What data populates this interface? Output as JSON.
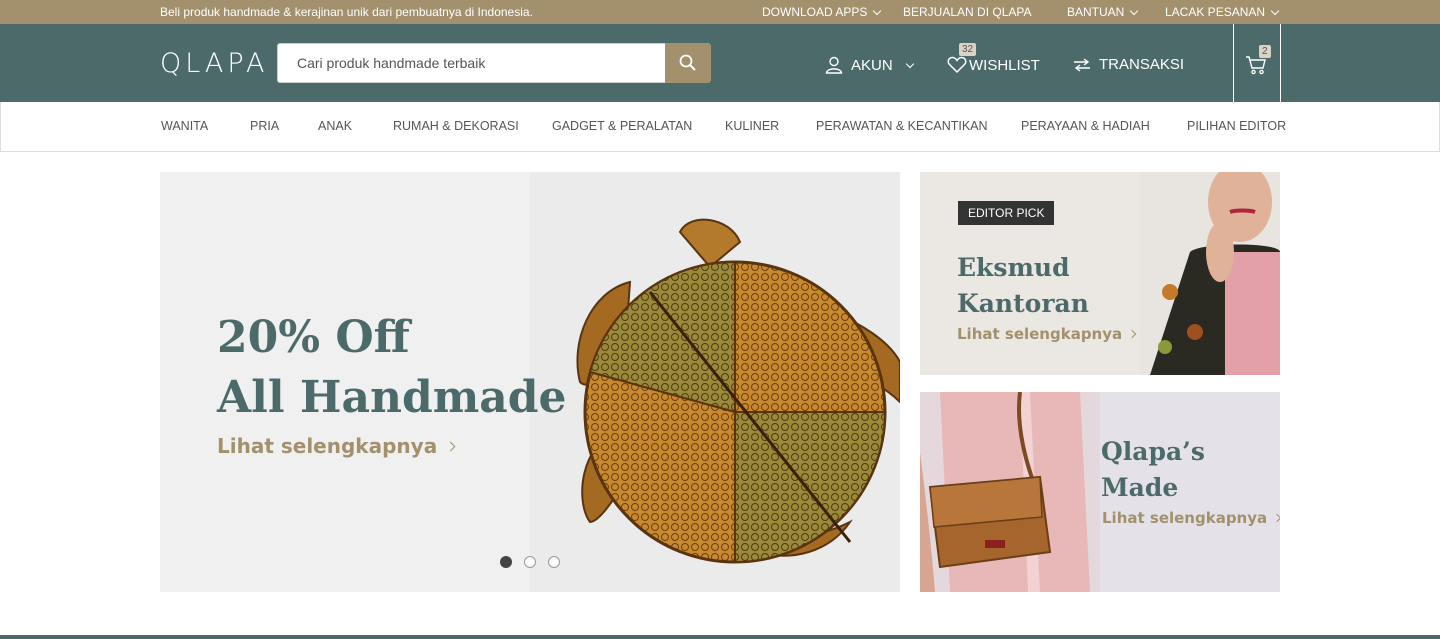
{
  "topbar": {
    "tagline": "Beli produk handmade & kerajinan unik dari pembuatnya di Indonesia.",
    "links": [
      {
        "label": "DOWNLOAD APPS",
        "has_dropdown": true
      },
      {
        "label": "BERJUALAN DI QLAPA",
        "has_dropdown": false
      },
      {
        "label": "BANTUAN",
        "has_dropdown": true
      },
      {
        "label": "LACAK PESANAN",
        "has_dropdown": true
      }
    ]
  },
  "header": {
    "logo": "QLAPA",
    "search_placeholder": "Cari produk handmade terbaik",
    "account_label": "AKUN",
    "wishlist_label": "WISHLIST",
    "wishlist_count": "32",
    "transactions_label": "TRANSAKSI",
    "cart_count": "2"
  },
  "categories": [
    "WANITA",
    "PRIA",
    "ANAK",
    "RUMAH & DEKORASI",
    "GADGET & PERALATAN",
    "KULINER",
    "PERAWATAN & KECANTIKAN",
    "PERAYAAN & HADIAH",
    "PILIHAN EDITOR"
  ],
  "hero": {
    "line1": "20% Off",
    "line2": "All Handmade",
    "cta": "Lihat selengkapnya",
    "slide_count": 3,
    "active_slide": 1
  },
  "promos": [
    {
      "badge": "EDITOR PICK",
      "title_line1": "Eksmud",
      "title_line2": "Kantoran",
      "cta": "Lihat selengkapnya"
    },
    {
      "title_line1": "Qlapa’s",
      "title_line2": "Made",
      "cta": "Lihat selengkapnya"
    }
  ],
  "colors": {
    "brand": "#4d6a6a",
    "accent": "#a3906c",
    "topbar": "#a3906c"
  }
}
